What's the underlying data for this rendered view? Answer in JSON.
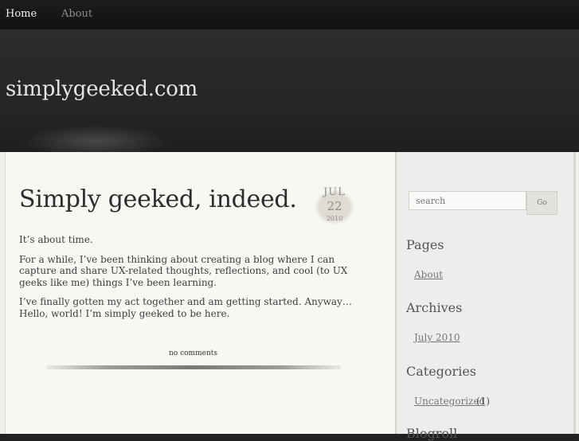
{
  "nav": {
    "home_label": "Home",
    "about_label": "About"
  },
  "header": {
    "site_title": "simplygeeked.com"
  },
  "post": {
    "title": "Simply geeked, indeed.",
    "date": {
      "month": "JUL",
      "day": "22",
      "year": "2010"
    },
    "paragraphs": [
      "It’s about time.",
      "For a while, I’ve been thinking about creating a blog where I can capture and share UX-related thoughts, reflections, and cool (to UX geeks like me) things I’ve been learning.",
      "I’ve finally gotten my act together and am getting started. Anyway…Hello, world! I’m simply geeked to be here."
    ],
    "comments_label": "no comments"
  },
  "sidebar": {
    "search": {
      "placeholder": "search",
      "button_label": "Go"
    },
    "widgets": [
      {
        "title": "Pages",
        "items": [
          {
            "label": "About"
          }
        ]
      },
      {
        "title": "Archives",
        "items": [
          {
            "label": "July 2010"
          }
        ]
      },
      {
        "title": "Categories",
        "items": [
          {
            "label": "Uncategorized",
            "count": "(1)"
          }
        ]
      },
      {
        "title": "Blogroll"
      }
    ]
  }
}
